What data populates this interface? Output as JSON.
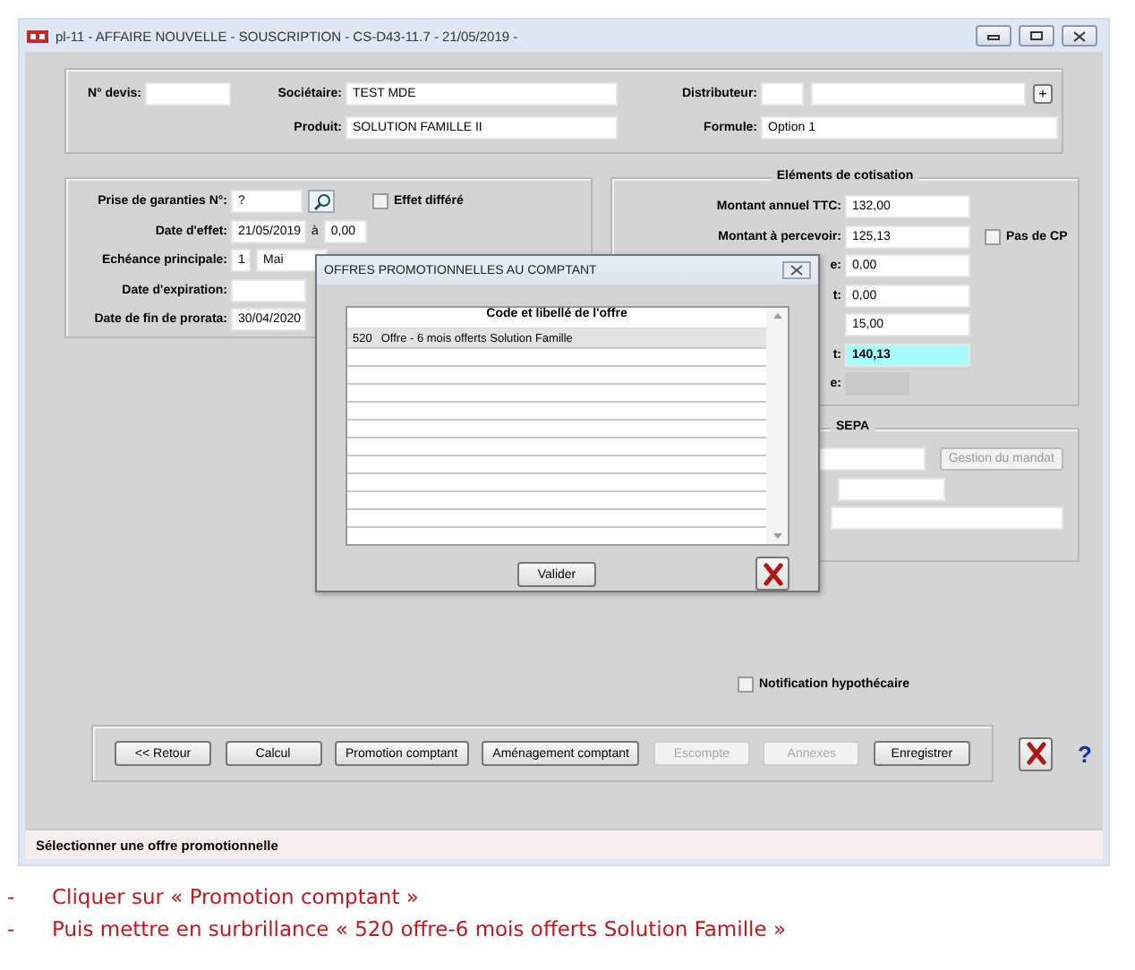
{
  "window": {
    "title": "pl-11 - AFFAIRE NOUVELLE - SOUSCRIPTION - CS-D43-11.7 - 21/05/2019 -"
  },
  "header": {
    "quote_number": {
      "label": "N° devis:"
    },
    "member": {
      "label": "Sociétaire:",
      "value": "TEST MDE"
    },
    "distributor": {
      "label": "Distributeur:",
      "button": "+"
    },
    "product": {
      "label": "Produit:",
      "value": "SOLUTION FAMILLE II"
    },
    "formula": {
      "label": "Formule:",
      "value": "Option 1"
    }
  },
  "guarantees": {
    "number": {
      "label": "Prise de garanties N°:",
      "value": "?"
    },
    "deferred": {
      "label": "Effet différé",
      "checked": false
    },
    "effective_date": {
      "label": "Date d'effet:",
      "value": "21/05/2019",
      "time_separator": "à",
      "time": "0,00"
    },
    "main_due_date": {
      "label": "Echéance principale:",
      "day": "1",
      "month": "Mai"
    },
    "expiry_date": {
      "label": "Date d'expiration:"
    },
    "prorata_end_date": {
      "label": "Date de fin de prorata:",
      "value": "30/04/2020"
    }
  },
  "contribution": {
    "title": "Eléments de cotisation",
    "no_cp": {
      "label": "Pas de CP",
      "checked": false
    },
    "rows": [
      {
        "kind": "amount",
        "label": "Montant annuel TTC:",
        "value": "132,00"
      },
      {
        "kind": "amount",
        "label": "Montant à percevoir:",
        "value": "125,13"
      },
      {
        "kind": "amount",
        "label": "e:",
        "value": "0,00"
      },
      {
        "kind": "amount",
        "label": "t:",
        "value": "0,00"
      },
      {
        "kind": "amount",
        "value": "15,00"
      },
      {
        "kind": "total",
        "label": "t:",
        "value": "140,13"
      },
      {
        "kind": "readonly",
        "label": "e:"
      }
    ]
  },
  "sepa": {
    "title": "SEPA",
    "manage_button": {
      "label": "Gestion du mandat",
      "disabled": true
    }
  },
  "mortgage_notification": {
    "label": "Notification hypothécaire",
    "checked": false
  },
  "buttons": [
    {
      "label": "<< Retour",
      "disabled": false
    },
    {
      "label": "Calcul",
      "disabled": false
    },
    {
      "label": "Promotion comptant",
      "disabled": false
    },
    {
      "label": "Aménagement comptant",
      "disabled": false
    },
    {
      "label": "Escompte",
      "disabled": true
    },
    {
      "label": "Annexes",
      "disabled": true
    },
    {
      "label": "Enregistrer",
      "disabled": false
    }
  ],
  "help": "?",
  "status_bar": "Sélectionner une offre promotionnelle",
  "dialog": {
    "title": "OFFRES PROMOTIONNELLES AU COMPTANT",
    "column": "Code et libellé de l'offre",
    "offers": [
      {
        "code": "520",
        "label": "Offre - 6 mois offerts Solution Famille",
        "selected": true
      }
    ],
    "validate_button": "Valider"
  },
  "instructions": [
    {
      "bullet": "-",
      "text": "Cliquer sur « Promotion comptant »"
    },
    {
      "bullet": "-",
      "text": "Puis mettre en surbrillance « 520 offre-6 mois offerts Solution Famille »"
    }
  ]
}
